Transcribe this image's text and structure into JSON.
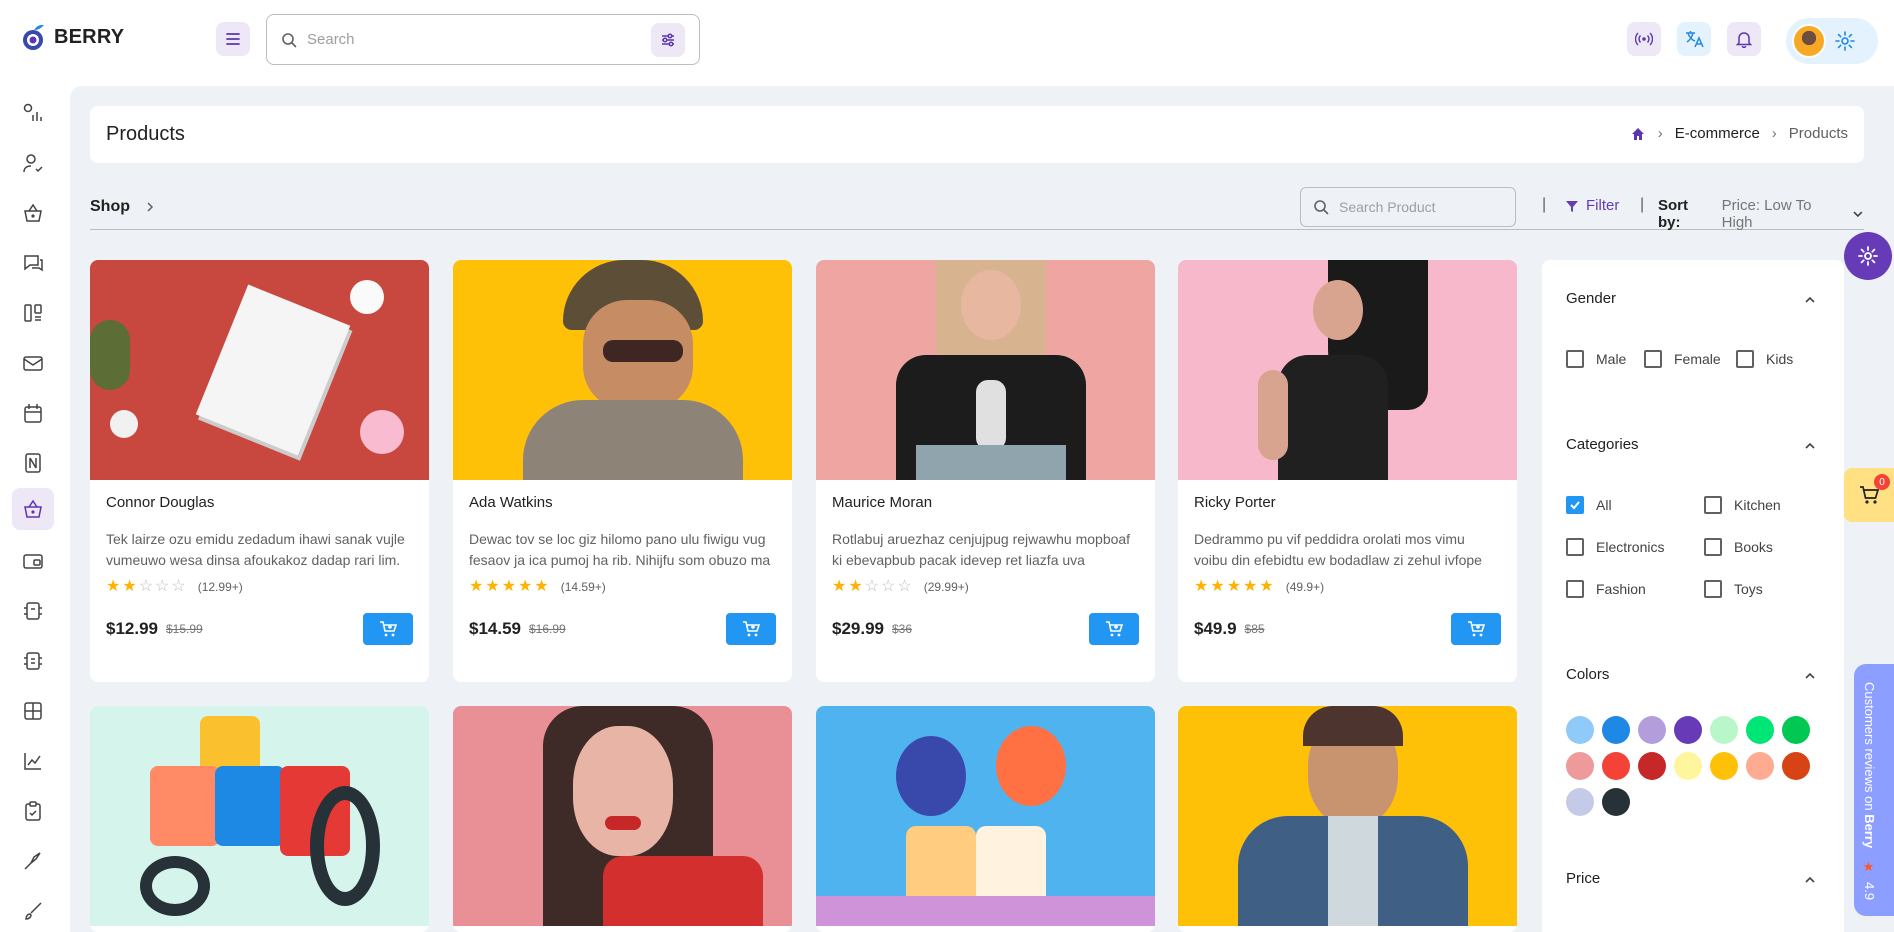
{
  "brand": {
    "name": "BERRY"
  },
  "search": {
    "placeholder": "Search"
  },
  "page": {
    "title": "Products",
    "breadcrumbs": [
      "E-commerce",
      "Products"
    ]
  },
  "shopbar": {
    "shop_label": "Shop",
    "search_placeholder": "Search Product",
    "divider": "|",
    "filter_label": "Filter",
    "sort_label": "Sort by:",
    "sort_value": "Price: Low To High"
  },
  "products": [
    {
      "name": "Connor Douglas",
      "desc": "Tek lairze ozu emidu zedadum ihawi sanak vujle vumeuwo wesa dinsa afoukakoz dadap rari lim.",
      "rating": 1.5,
      "reviews": "(12.99+)",
      "price": "$12.99",
      "old_price": "$15.99"
    },
    {
      "name": "Ada Watkins",
      "desc": "Dewac tov se loc giz hilomo pano ulu fiwigu vug fesaov ja ica pumoj ha rib. Nihijfu som obuzo ma",
      "rating": 5,
      "reviews": "(14.59+)",
      "price": "$14.59",
      "old_price": "$16.99"
    },
    {
      "name": "Maurice Moran",
      "desc": "Rotlabuj aruezhaz cenjujpug rejwawhu mopboaf ki ebevapbub pacak idevep ret liazfa uva saonuke",
      "rating": 1.5,
      "reviews": "(29.99+)",
      "price": "$29.99",
      "old_price": "$36"
    },
    {
      "name": "Ricky Porter",
      "desc": "Dedrammo pu vif peddidra orolati mos vimu voibu din efebidtu ew bodadlaw zi zehul ivfope",
      "rating": 5,
      "reviews": "(49.9+)",
      "price": "$49.9",
      "old_price": "$85"
    }
  ],
  "filters": {
    "gender": {
      "title": "Gender",
      "options": [
        "Male",
        "Female",
        "Kids"
      ]
    },
    "categories": {
      "title": "Categories",
      "options": [
        "All",
        "Kitchen",
        "Electronics",
        "Books",
        "Fashion",
        "Toys"
      ],
      "selected": "All"
    },
    "colors": {
      "title": "Colors",
      "swatches": [
        "#90caf9",
        "#1e88e5",
        "#b39ddb",
        "#673ab7",
        "#b9f6ca",
        "#00e676",
        "#00c853",
        "#ef9a9a",
        "#f44336",
        "#c62828",
        "#fff59d",
        "#ffc107",
        "#ffab91",
        "#d84315",
        "#c5cae9",
        "#263238"
      ]
    },
    "price": {
      "title": "Price"
    }
  },
  "cart": {
    "count": "0"
  },
  "reviews_banner": {
    "text_prefix": "Customers reviews on ",
    "brand": "Berry",
    "score": "4.9"
  },
  "colors": {
    "primary": "#673ab7",
    "secondary": "#2196f3",
    "background": "#eef2f6"
  }
}
